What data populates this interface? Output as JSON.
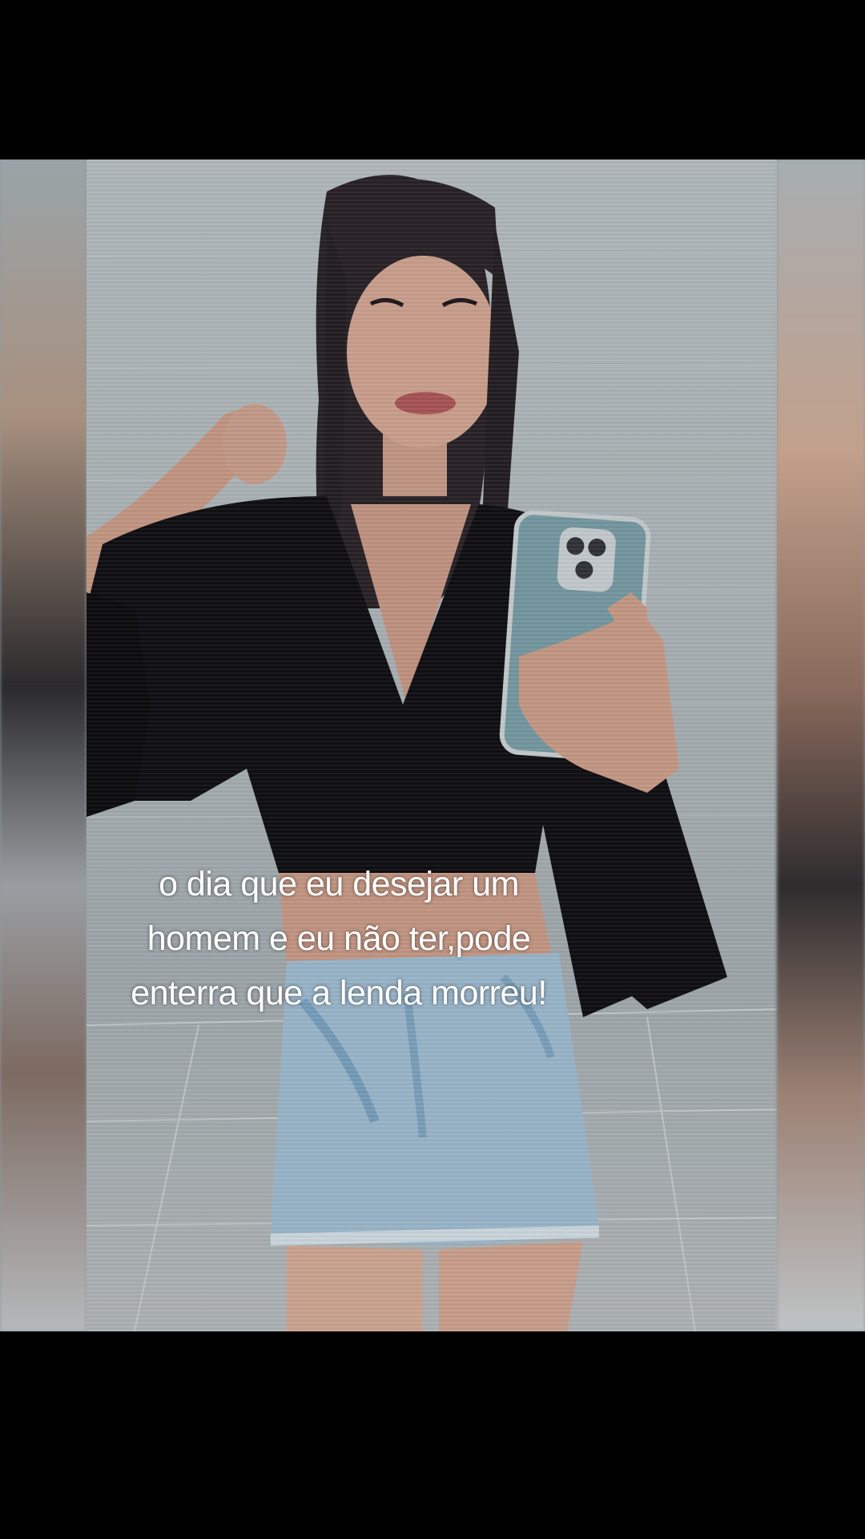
{
  "video": {
    "caption_lines": [
      "o dia que eu desejar um",
      "homem e eu não ter,pode",
      "enterra que a lenda morreu!"
    ]
  },
  "colors": {
    "background": "#000000",
    "caption_text": "#ffffff",
    "top_black": "#0b0b0d",
    "skirt_denim": "#a9c7dc"
  }
}
